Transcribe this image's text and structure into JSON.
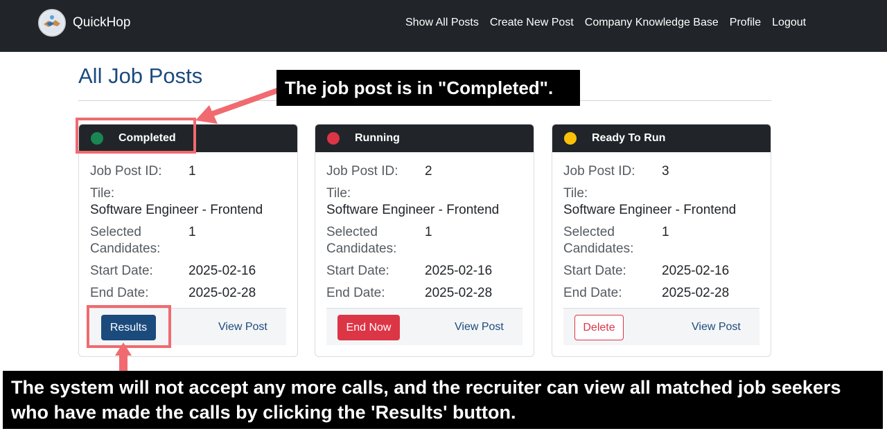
{
  "navbar": {
    "brand": "QuickHop",
    "links": [
      "Show All Posts",
      "Create New Post",
      "Company Knowledge Base",
      "Profile",
      "Logout"
    ]
  },
  "page": {
    "title": "All Job Posts"
  },
  "labels": {
    "job_post_id": "Job Post ID:",
    "title": "Tile:",
    "selected_candidates": "Selected Candidates:",
    "start_date": "Start Date:",
    "end_date": "End Date:",
    "view_post": "View Post"
  },
  "cards": [
    {
      "status": "Completed",
      "status_color": "#198754",
      "id": "1",
      "title": "Software Engineer - Frontend",
      "selected": "1",
      "start": "2025-02-16",
      "end": "2025-02-28",
      "action": "Results"
    },
    {
      "status": "Running",
      "status_color": "#dc3545",
      "id": "2",
      "title": "Software Engineer - Frontend",
      "selected": "1",
      "start": "2025-02-16",
      "end": "2025-02-28",
      "action": "End Now"
    },
    {
      "status": "Ready To Run",
      "status_color": "#ffc107",
      "id": "3",
      "title": "Software Engineer - Frontend",
      "selected": "1",
      "start": "2025-02-16",
      "end": "2025-02-28",
      "action": "Delete"
    }
  ],
  "annotations": {
    "top": "The job post is in \"Completed\".",
    "bottom_line1": "The system will not accept any more calls, and the recruiter can view all matched job seekers",
    "bottom_line2": "who have made the calls by clicking the 'Results' button.",
    "color": "#f06a6f"
  },
  "icons": {
    "logo": "handshake-logo-icon"
  }
}
